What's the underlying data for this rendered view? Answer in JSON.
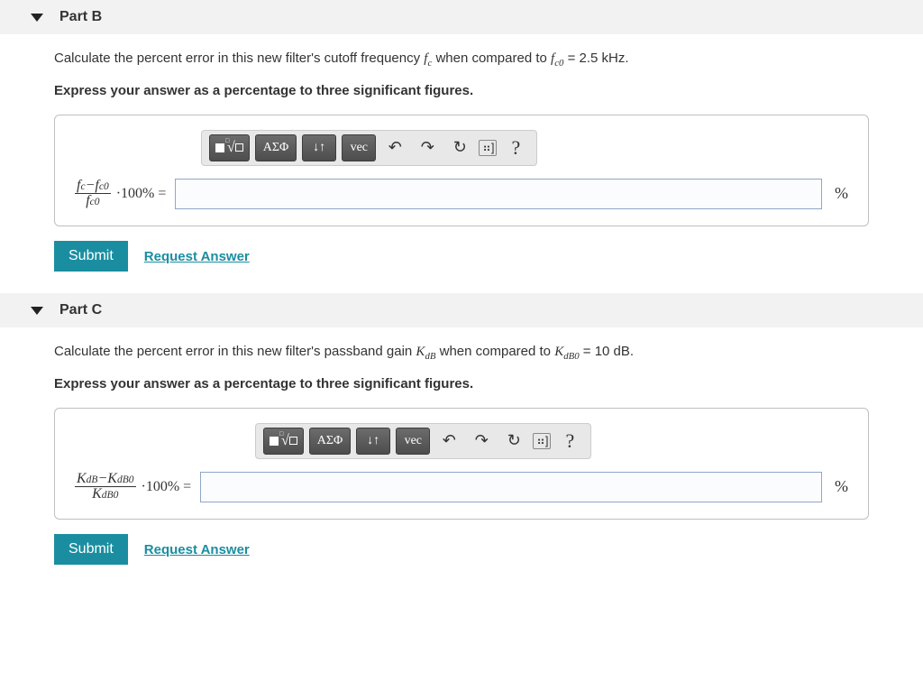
{
  "parts": [
    {
      "label": "Part B",
      "prompt_pre": "Calculate the percent error in this new filter's cutoff frequency ",
      "prompt_sym1": "f_c",
      "prompt_mid": " when compared to ",
      "prompt_sym2": "f_{c0}",
      "prompt_eq": " = 2.5 kHz.",
      "instruction": "Express your answer as a percentage to three significant figures.",
      "toolbar": {
        "templates": "templates",
        "greek": "ΑΣΦ",
        "subsup": "↓↑",
        "vec": "vec",
        "undo": "↶",
        "redo": "↷",
        "reset": "↻",
        "keyboard": "⌨",
        "help": "?"
      },
      "lhs_num_a": "f_c",
      "lhs_num_minus": "−",
      "lhs_num_b": "f_{c0}",
      "lhs_den": "f_{c0}",
      "lhs_tail": "·100% =",
      "input_value": "",
      "unit": "%",
      "submit": "Submit",
      "request": "Request Answer"
    },
    {
      "label": "Part C",
      "prompt_pre": "Calculate the percent error in this new filter's passband gain ",
      "prompt_sym1": "K_{dB}",
      "prompt_mid": " when compared to ",
      "prompt_sym2": "K_{dB0}",
      "prompt_eq": " = 10 dB.",
      "instruction": "Express your answer as a percentage to three significant figures.",
      "toolbar": {
        "templates": "templates",
        "greek": "ΑΣΦ",
        "subsup": "↓↑",
        "vec": "vec",
        "undo": "↶",
        "redo": "↷",
        "reset": "↻",
        "keyboard": "⌨",
        "help": "?"
      },
      "lhs_num_a": "K_{dB}",
      "lhs_num_minus": "−",
      "lhs_num_b": "K_{dB0}",
      "lhs_den": "K_{dB0}",
      "lhs_tail": "·100% =",
      "input_value": "",
      "unit": "%",
      "submit": "Submit",
      "request": "Request Answer"
    }
  ]
}
